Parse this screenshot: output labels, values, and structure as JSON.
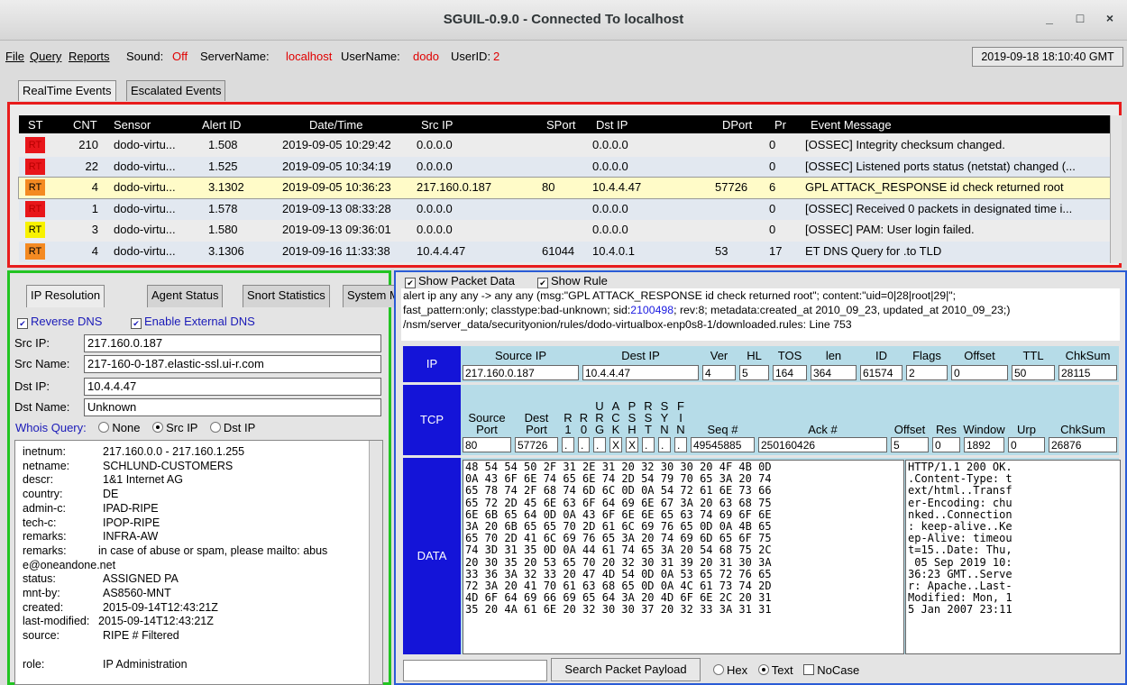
{
  "window": {
    "title": "SGUIL-0.9.0 - Connected To localhost",
    "minimize": "_",
    "maximize": "□",
    "close": "×"
  },
  "menu": {
    "file": "File",
    "query": "Query",
    "reports": "Reports",
    "sound_label": "Sound:",
    "sound_value": "Off",
    "server_label": "ServerName:",
    "server_value": "localhost",
    "user_label": "UserName:",
    "user_value": "dodo",
    "userid_label": "UserID:",
    "userid_value": "2",
    "clock": "2019-09-18 18:10:40 GMT"
  },
  "top_tabs": [
    "RealTime Events",
    "Escalated Events"
  ],
  "events": {
    "columns": [
      "ST",
      "CNT",
      "Sensor",
      "Alert ID",
      "Date/Time",
      "Src IP",
      "SPort",
      "Dst IP",
      "DPort",
      "Pr",
      "Event Message"
    ],
    "rows": [
      {
        "st": "RT",
        "cnt": "210",
        "sensor": "dodo-virtu...",
        "alert_id": "1.508",
        "datetime": "2019-09-05 10:29:42",
        "src_ip": "0.0.0.0",
        "sport": "",
        "dst_ip": "0.0.0.0",
        "dport": "",
        "pr": "0",
        "msg": "[OSSEC] Integrity checksum changed."
      },
      {
        "st": "RT",
        "cnt": "22",
        "sensor": "dodo-virtu...",
        "alert_id": "1.525",
        "datetime": "2019-09-05 10:34:19",
        "src_ip": "0.0.0.0",
        "sport": "",
        "dst_ip": "0.0.0.0",
        "dport": "",
        "pr": "0",
        "msg": "[OSSEC] Listened ports status (netstat) changed (..."
      },
      {
        "st": "RT",
        "cnt": "4",
        "sensor": "dodo-virtu...",
        "alert_id": "3.1302",
        "datetime": "2019-09-05 10:36:23",
        "src_ip": "217.160.0.187",
        "sport": "80",
        "dst_ip": "10.4.4.47",
        "dport": "57726",
        "pr": "6",
        "msg": "GPL ATTACK_RESPONSE id check returned root"
      },
      {
        "st": "RT",
        "cnt": "1",
        "sensor": "dodo-virtu...",
        "alert_id": "1.578",
        "datetime": "2019-09-13 08:33:28",
        "src_ip": "0.0.0.0",
        "sport": "",
        "dst_ip": "0.0.0.0",
        "dport": "",
        "pr": "0",
        "msg": "[OSSEC] Received 0 packets in designated time i..."
      },
      {
        "st": "RT",
        "cnt": "3",
        "sensor": "dodo-virtu...",
        "alert_id": "1.580",
        "datetime": "2019-09-13 09:36:01",
        "src_ip": "0.0.0.0",
        "sport": "",
        "dst_ip": "0.0.0.0",
        "dport": "",
        "pr": "0",
        "msg": "[OSSEC] PAM: User login failed."
      },
      {
        "st": "RT",
        "cnt": "4",
        "sensor": "dodo-virtu...",
        "alert_id": "3.1306",
        "datetime": "2019-09-16 11:33:38",
        "src_ip": "10.4.4.47",
        "sport": "61044",
        "dst_ip": "10.4.0.1",
        "dport": "53",
        "pr": "17",
        "msg": "ET DNS Query for .to TLD"
      }
    ],
    "st_colors": [
      "#e8161b",
      "#e8161b",
      "#f48a22",
      "#e8161b",
      "#f8f200",
      "#f48a22"
    ],
    "st_text_colors": [
      "#b60000",
      "#b60000",
      "#000000",
      "#b60000",
      "#000000",
      "#000000"
    ],
    "selected_row_color": "#fffbc8"
  },
  "left": {
    "tabs": [
      "IP Resolution",
      "Agent Status",
      "Snort Statistics",
      "System M"
    ],
    "reverse_dns": "Reverse DNS",
    "external_dns": "Enable External DNS",
    "src_ip_label": "Src IP:",
    "src_ip": "217.160.0.187",
    "src_name_label": "Src Name:",
    "src_name": "217-160-0-187.elastic-ssl.ui-r.com",
    "dst_ip_label": "Dst IP:",
    "dst_ip": "10.4.4.47",
    "dst_name_label": "Dst Name:",
    "dst_name": "Unknown",
    "whois_label": "Whois Query:",
    "whois_none": "None",
    "whois_src": "Src IP",
    "whois_dst": "Dst IP",
    "whois_lines": [
      {
        "k": "inetnum:",
        "v": "217.160.0.0 - 217.160.1.255"
      },
      {
        "k": "netname:",
        "v": "SCHLUND-CUSTOMERS"
      },
      {
        "k": "descr:",
        "v": "1&1 Internet AG"
      },
      {
        "k": "country:",
        "v": "DE"
      },
      {
        "k": "admin-c:",
        "v": "IPAD-RIPE"
      },
      {
        "k": "tech-c:",
        "v": "IPOP-RIPE"
      },
      {
        "k": "remarks:",
        "v": "INFRA-AW"
      },
      {
        "k": "remarks:",
        "v": "in case of abuse or spam, please mailto: abus"
      },
      {
        "k": "e@oneandone.net",
        "v": ""
      },
      {
        "k": "status:",
        "v": "ASSIGNED PA"
      },
      {
        "k": "mnt-by:",
        "v": "AS8560-MNT"
      },
      {
        "k": "created:",
        "v": "2015-09-14T12:43:21Z"
      },
      {
        "k": "last-modified:",
        "v": "2015-09-14T12:43:21Z"
      },
      {
        "k": "source:",
        "v": "RIPE # Filtered"
      },
      {
        "k": "",
        "v": ""
      },
      {
        "k": "role:",
        "v": "IP Administration"
      }
    ]
  },
  "right": {
    "show_packet_data": "Show Packet Data",
    "show_rule": "Show Rule",
    "rule_line1_a": "alert ip any any -> any any (msg:\"GPL ATTACK_RESPONSE id check returned root\"; content:\"uid=0|28|root|29|\";",
    "rule_line2_a": "fast_pattern:only; classtype:bad-unknown; sid:",
    "rule_line2_sid": "2100498",
    "rule_line2_b": "; rev:8; metadata:created_at 2010_09_23, updated_at 2010_09_23;)",
    "rule_line3": "/nsm/server_data/securityonion/rules/dodo-virtualbox-enp0s8-1/downloaded.rules: Line 753",
    "ip": {
      "label": "IP",
      "headers": [
        "Source IP",
        "Dest IP",
        "Ver",
        "HL",
        "TOS",
        "len",
        "ID",
        "Flags",
        "Offset",
        "TTL",
        "ChkSum"
      ],
      "values": [
        "217.160.0.187",
        "10.4.4.47",
        "4",
        "5",
        "164",
        "364",
        "61574",
        "2",
        "0",
        "50",
        "28115"
      ]
    },
    "tcp": {
      "label": "TCP",
      "headers": [
        "Source\nPort",
        "Dest\nPort",
        "R\n1",
        "R\n0",
        "U\nR\nG",
        "A\nC\nK",
        "P\nS\nH",
        "R\nS\nT",
        "S\nY\nN",
        "F\nI\nN",
        "Seq #",
        "Ack #",
        "Offset",
        "Res",
        "Window",
        "Urp",
        "ChkSum"
      ],
      "values": [
        "80",
        "57726",
        ".",
        ".",
        ".",
        "X",
        "X",
        ".",
        ".",
        ".",
        "49545885",
        "250160426",
        "5",
        "0",
        "1892",
        "0",
        "26876"
      ]
    },
    "data": {
      "label": "DATA",
      "hex": [
        "48 54 54 50 2F 31 2E 31 20 32 30 30 20 4F 4B 0D",
        "0A 43 6F 6E 74 65 6E 74 2D 54 79 70 65 3A 20 74",
        "65 78 74 2F 68 74 6D 6C 0D 0A 54 72 61 6E 73 66",
        "65 72 2D 45 6E 63 6F 64 69 6E 67 3A 20 63 68 75",
        "6E 6B 65 64 0D 0A 43 6F 6E 6E 65 63 74 69 6F 6E",
        "3A 20 6B 65 65 70 2D 61 6C 69 76 65 0D 0A 4B 65",
        "65 70 2D 41 6C 69 76 65 3A 20 74 69 6D 65 6F 75",
        "74 3D 31 35 0D 0A 44 61 74 65 3A 20 54 68 75 2C",
        "20 30 35 20 53 65 70 20 32 30 31 39 20 31 30 3A",
        "33 36 3A 32 33 20 47 4D 54 0D 0A 53 65 72 76 65",
        "72 3A 20 41 70 61 63 68 65 0D 0A 4C 61 73 74 2D",
        "4D 6F 64 69 66 69 65 64 3A 20 4D 6F 6E 2C 20 31",
        "35 20 4A 61 6E 20 32 30 30 37 20 32 33 3A 31 31"
      ],
      "ascii": [
        "HTTP/1.1 200 OK.",
        ".Content-Type: t",
        "ext/html..Transf",
        "er-Encoding: chu",
        "nked..Connection",
        ": keep-alive..Ke",
        "ep-Alive: timeou",
        "t=15..Date: Thu,",
        " 05 Sep 2019 10:",
        "36:23 GMT..Serve",
        "r: Apache..Last-",
        "Modified: Mon, 1",
        "5 Jan 2007 23:11"
      ]
    },
    "search_button": "Search Packet Payload",
    "hex": "Hex",
    "text": "Text",
    "nocase": "NoCase"
  }
}
